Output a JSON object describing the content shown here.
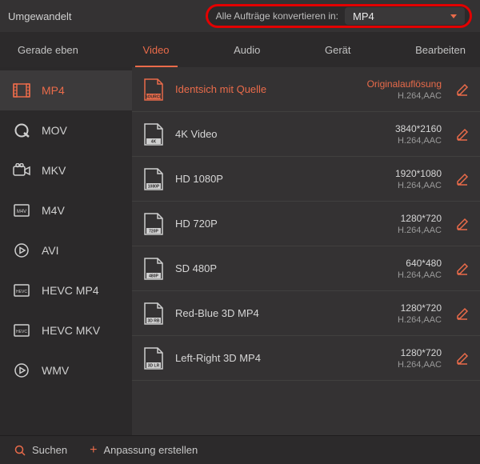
{
  "colors": {
    "accent": "#ea6b4a",
    "highlight_border": "#e30000"
  },
  "topbar": {
    "title": "Umgewandelt",
    "convert_label": "Alle Aufträge konvertieren in:",
    "convert_value": "MP4"
  },
  "tabs": [
    {
      "label": "Gerade eben",
      "active": false
    },
    {
      "label": "Video",
      "active": true
    },
    {
      "label": "Audio",
      "active": false
    },
    {
      "label": "Gerät",
      "active": false
    },
    {
      "label": "Bearbeiten",
      "active": false
    }
  ],
  "sidebar": [
    {
      "label": "MP4",
      "icon": "film",
      "active": true
    },
    {
      "label": "MOV",
      "icon": "q",
      "active": false
    },
    {
      "label": "MKV",
      "icon": "cam",
      "active": false
    },
    {
      "label": "M4V",
      "icon": "m4v",
      "active": false
    },
    {
      "label": "AVI",
      "icon": "play",
      "active": false
    },
    {
      "label": "HEVC MP4",
      "icon": "hevc",
      "active": false
    },
    {
      "label": "HEVC MKV",
      "icon": "hevc",
      "active": false
    },
    {
      "label": "WMV",
      "icon": "play",
      "active": false
    }
  ],
  "presets": [
    {
      "name": "Identsich mit Quelle",
      "tag": "SOURCE",
      "res": "Originalauflösung",
      "codec": "H.264,AAC",
      "active": true
    },
    {
      "name": "4K Video",
      "tag": "4K",
      "res": "3840*2160",
      "codec": "H.264,AAC",
      "active": false
    },
    {
      "name": "HD 1080P",
      "tag": "1080P",
      "res": "1920*1080",
      "codec": "H.264,AAC",
      "active": false
    },
    {
      "name": "HD 720P",
      "tag": "720P",
      "res": "1280*720",
      "codec": "H.264,AAC",
      "active": false
    },
    {
      "name": "SD 480P",
      "tag": "480P",
      "res": "640*480",
      "codec": "H.264,AAC",
      "active": false
    },
    {
      "name": "Red-Blue 3D MP4",
      "tag": "3D RB",
      "res": "1280*720",
      "codec": "H.264,AAC",
      "active": false
    },
    {
      "name": "Left-Right 3D MP4",
      "tag": "3D LR",
      "res": "1280*720",
      "codec": "H.264,AAC",
      "active": false
    }
  ],
  "bottombar": {
    "search_label": "Suchen",
    "create_label": "Anpassung erstellen"
  }
}
